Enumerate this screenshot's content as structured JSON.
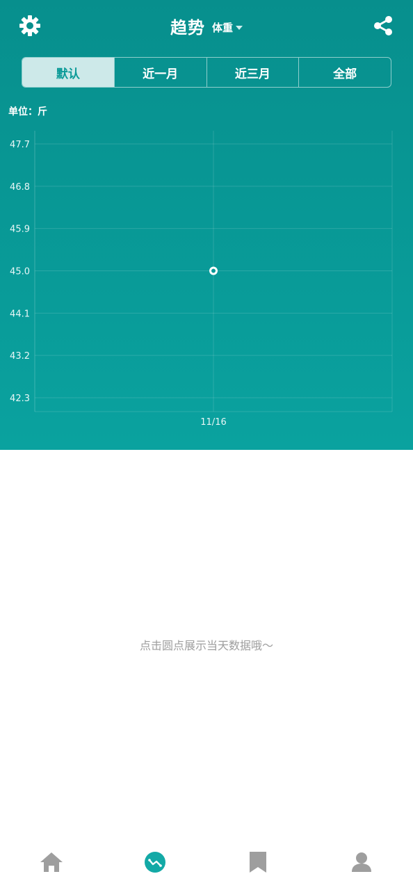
{
  "header": {
    "title": "趋势",
    "metric": "体重"
  },
  "tabs": [
    {
      "label": "默认",
      "active": true
    },
    {
      "label": "近一月",
      "active": false
    },
    {
      "label": "近三月",
      "active": false
    },
    {
      "label": "全部",
      "active": false
    }
  ],
  "unit_label": "单位：斤",
  "hint": "点击圆点展示当天数据哦～",
  "colors": {
    "teal_top": "#078f8d",
    "teal_bottom": "#0aa29f",
    "active_tab_bg": "#cde9e9",
    "nav_active": "#13a9a6",
    "nav_inactive": "#9e9e9e"
  },
  "nav": [
    {
      "name": "home-icon",
      "active": false
    },
    {
      "name": "trend-icon",
      "active": true
    },
    {
      "name": "bookmark-icon",
      "active": false
    },
    {
      "name": "user-icon",
      "active": false
    }
  ],
  "chart_data": {
    "type": "scatter",
    "x": [
      "11/16"
    ],
    "y": [
      45.0
    ],
    "yticks": [
      "47.7",
      "46.8",
      "45.9",
      "45.0",
      "44.1",
      "43.2",
      "42.3"
    ],
    "ylim": [
      42.3,
      47.7
    ],
    "grid": true,
    "title": "",
    "xlabel": "",
    "ylabel": ""
  }
}
